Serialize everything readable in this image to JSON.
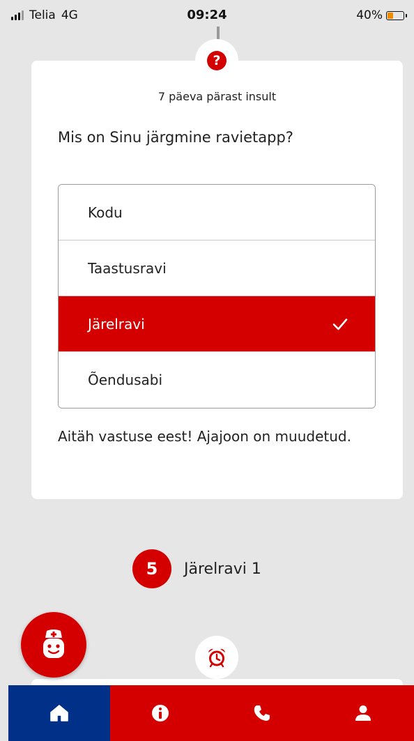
{
  "status_bar": {
    "carrier": "Telia",
    "network": "4G",
    "time": "09:24",
    "battery_percent": "40%",
    "battery_level": 0.4,
    "battery_color": "#f08a00"
  },
  "question_card": {
    "icon": "question-icon",
    "meta": "7 päeva pärast insult",
    "question": "Mis on Sinu järgmine ravietapp?",
    "options": [
      {
        "label": "Kodu",
        "selected": false
      },
      {
        "label": "Taastusravi",
        "selected": false
      },
      {
        "label": "Järelravi",
        "selected": true
      },
      {
        "label": "Õendusabi",
        "selected": false
      }
    ],
    "feedback": "Aitäh vastuse eest! Ajajoon on muudetud."
  },
  "timeline_step": {
    "number": "5",
    "label": "Järelravi 1"
  },
  "next_card": {
    "icon": "alarm-clock-icon"
  },
  "fab": {
    "icon": "nurse-icon"
  },
  "bottom_nav": {
    "items": [
      {
        "icon": "home-icon",
        "active": true
      },
      {
        "icon": "info-icon",
        "active": false
      },
      {
        "icon": "phone-icon",
        "active": false
      },
      {
        "icon": "profile-icon",
        "active": false
      }
    ]
  },
  "colors": {
    "accent_red": "#d40000",
    "nav_active_blue": "#003087",
    "background": "#e6e6e6"
  }
}
